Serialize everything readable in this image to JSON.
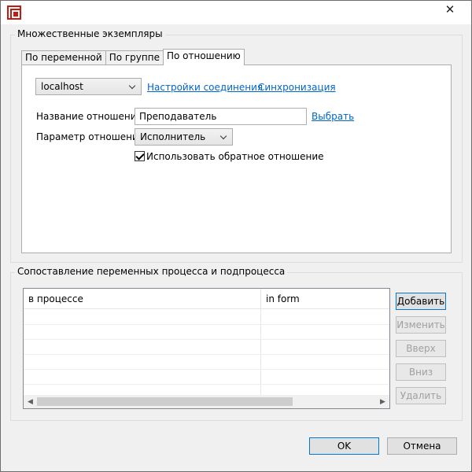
{
  "window": {
    "title": "",
    "close_glyph": "✕"
  },
  "multi_instance": {
    "caption": "Множественные экземпляры",
    "tabs": [
      {
        "label": "По переменной"
      },
      {
        "label": "По группе"
      },
      {
        "label": "По отношению"
      }
    ],
    "active_tab": 2,
    "server_combo": {
      "value": "localhost"
    },
    "connection_settings_link": "Настройки соединения",
    "sync_link": "Синхронизация",
    "relation_name": {
      "label": "Название отношения",
      "value": "Преподаватель",
      "choose_link": "Выбрать"
    },
    "relation_param": {
      "label": "Параметр отношения",
      "value": "Исполнитель"
    },
    "use_reverse": {
      "label": "Использовать обратное отношение",
      "checked": true
    }
  },
  "mapping": {
    "caption": "Сопоставление переменных процесса и подпроцесса",
    "columns": [
      "в процессе",
      "in form"
    ],
    "rows": [
      [
        "",
        ""
      ],
      [
        "",
        ""
      ],
      [
        "",
        ""
      ],
      [
        "",
        ""
      ],
      [
        "",
        ""
      ],
      [
        "",
        ""
      ]
    ],
    "scroll_left": "◀",
    "scroll_right": "▶",
    "buttons": {
      "add": "Добавить",
      "edit": "Изменить",
      "up": "Вверх",
      "down": "Вниз",
      "delete": "Удалить"
    }
  },
  "footer": {
    "ok": "OK",
    "cancel": "Отмена"
  },
  "icons": {
    "app": "app-logo-icon",
    "close": "close-icon",
    "dropdown": "chevron-down-icon",
    "checkbox": "checkmark-icon"
  },
  "colors": {
    "link": "#0066cc",
    "app_icon": "#c21b12",
    "default_button_border": "#0078d7"
  }
}
